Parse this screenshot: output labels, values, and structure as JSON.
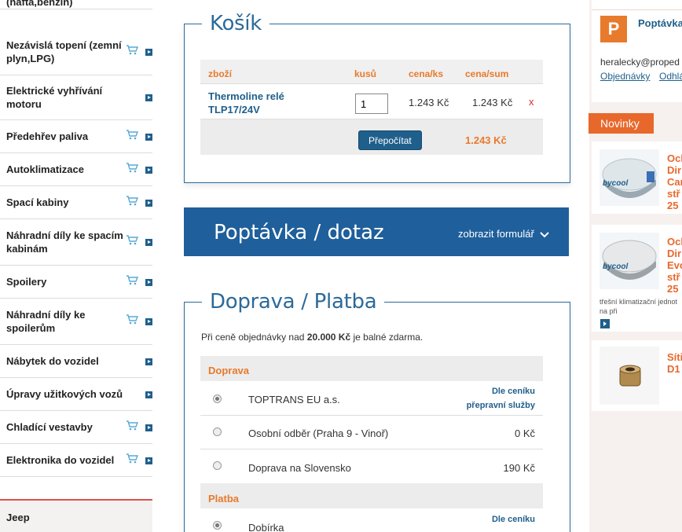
{
  "sidebar": {
    "items": [
      {
        "label": "Nezávislá topení (nafta,benzín)",
        "cart": true
      },
      {
        "label": "Nezávislá topení (zemní plyn,LPG)",
        "cart": true
      },
      {
        "label": "Elektrické vyhřívání motoru",
        "cart": false
      },
      {
        "label": "Předehřev paliva",
        "cart": true
      },
      {
        "label": "Autoklimatizace",
        "cart": true
      },
      {
        "label": "Spací kabiny",
        "cart": true
      },
      {
        "label": "Náhradní díly ke spacím kabinám",
        "cart": true
      },
      {
        "label": "Spoilery",
        "cart": true
      },
      {
        "label": "Náhradní díly ke spoilerům",
        "cart": true
      },
      {
        "label": "Nábytek do vozidel",
        "cart": false
      },
      {
        "label": "Úpravy užitkových vozů",
        "cart": false
      },
      {
        "label": "Chladící vestavby",
        "cart": true
      },
      {
        "label": "Elektronika do vozidel",
        "cart": true
      }
    ],
    "jeep": "Jeep"
  },
  "cart": {
    "title": "Košík",
    "headers": {
      "item": "zboží",
      "qty": "kusů",
      "price": "cena/ks",
      "sum": "cena/sum"
    },
    "row": {
      "name": "Thermoline relé TLP17/24V",
      "qty": "1",
      "price": "1.243 Kč",
      "sum": "1.243 Kč",
      "remove": "x"
    },
    "recalc": "Přepočítat",
    "total": "1.243 Kč"
  },
  "inquiry": {
    "title": "Poptávka / dotaz",
    "toggle": "zobrazit formulář"
  },
  "shipping": {
    "title": "Doprava / Platba",
    "note_pre": "Při ceně objednávky nad ",
    "note_amount": "20.000 Kč",
    "note_post": " je balné zdarma.",
    "doprava_header": "Doprava",
    "options": [
      {
        "name": "TOPTRANS EU a.s.",
        "price_line1": "Dle ceníku",
        "price_line2": "přepravní služby",
        "checked": true
      },
      {
        "name": "Osobní odběr (Praha 9 - Vinoř)",
        "price": "0 Kč",
        "checked": false
      },
      {
        "name": "Doprava na Slovensko",
        "price": "190 Kč",
        "checked": false
      }
    ],
    "platba_header": "Platba",
    "payment": {
      "name": "Dobírka",
      "price_line1": "Dle ceníku",
      "checked": true
    }
  },
  "right": {
    "p_icon": "P",
    "p_title": "Poptávka",
    "email": "heralecky@proped",
    "links": [
      "Objednávky",
      "Odhlá"
    ],
    "novinky": "Novinky",
    "products": [
      {
        "title_lines": [
          "Och",
          "Dir",
          "Can",
          "stř",
          "25"
        ],
        "brand": "bycool"
      },
      {
        "title_lines": [
          "Och",
          "Dir",
          "Evo",
          "stř",
          "25"
        ],
        "brand": "bycool",
        "desc": "třešní klimatizační jednot na při"
      },
      {
        "title_lines": [
          "Síti",
          "D1"
        ]
      }
    ]
  },
  "colors": {
    "blue": "#2c6a9a",
    "orange": "#e87a2c",
    "dark_blue": "#1f5f8b"
  }
}
